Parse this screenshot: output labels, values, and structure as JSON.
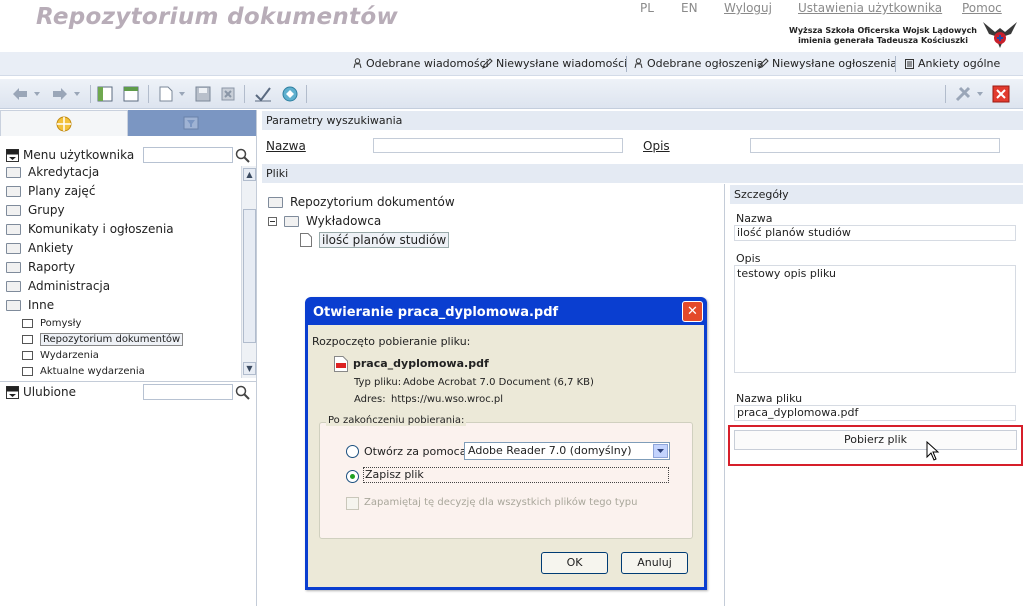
{
  "header": {
    "title": "Repozytorium dokumentów",
    "nav": [
      "PL",
      "EN",
      "Wyloguj",
      "Ustawienia użytkownika",
      "Pomoc"
    ],
    "school_line1": "Wyższa Szkoła Oficerska Wojsk Lądowych",
    "school_line2": "imienia generała Tadeusza Kościuszki"
  },
  "messages": {
    "received_msgs": "Odebrane wiadomości",
    "unsent_msgs": "Niewysłane wiadomości",
    "received_ann": "Odebrane ogłoszenia",
    "unsent_ann": "Niewysłane ogłoszenia",
    "surveys": "Ankiety ogólne"
  },
  "sidebar": {
    "menu_label": "Menu użytkownika",
    "favorites_label": "Ulubione",
    "items": [
      "Akredytacja",
      "Plany zajęć",
      "Grupy",
      "Komunikaty i ogłoszenia",
      "Ankiety",
      "Raporty",
      "Administracja",
      "Inne"
    ],
    "subitems": [
      "Pomysły",
      "Repozytorium dokumentów",
      "Wydarzenia",
      "Aktualne wydarzenia"
    ]
  },
  "search_params": {
    "header": "Parametry wyszukiwania",
    "name_label": "Nazwa",
    "desc_label": "Opis",
    "name_value": "",
    "desc_value": ""
  },
  "files": {
    "header": "Pliki",
    "root": "Repozytorium dokumentów",
    "folder": "Wykładowca",
    "file": "ilość planów studiów"
  },
  "details": {
    "header": "Szczegóły",
    "name_label": "Nazwa",
    "name_value": "ilość planów studiów",
    "desc_label": "Opis",
    "desc_value": "testowy opis pliku",
    "filename_label": "Nazwa pliku",
    "filename_value": "praca_dyplomowa.pdf",
    "download_button": "Pobierz plik"
  },
  "dialog": {
    "title": "Otwieranie praca_dyplomowa.pdf",
    "started": "Rozpoczęto pobieranie pliku:",
    "filename": "praca_dyplomowa.pdf",
    "type_label": "Typ pliku:",
    "type_value": "Adobe Acrobat 7.0 Document (6,7 KB)",
    "addr_label": "Adres:",
    "addr_value": "https://wu.wso.wroc.pl",
    "after_label": "Po zakończeniu pobierania:",
    "open_with": "Otwórz za pomocą",
    "open_with_app": "Adobe Reader 7.0 (domyślny)",
    "save_file": "Zapisz plik",
    "remember": "Zapamiętaj tę decyzję dla wszystkich plików tego typu",
    "ok": "OK",
    "cancel": "Anuluj",
    "selected_option": "save_file"
  },
  "colors": {
    "accent_red": "#d61f2a",
    "dialog_blue": "#0a3ed0",
    "title_gray": "#b8adb8",
    "tab_blue": "#7b96c2"
  }
}
